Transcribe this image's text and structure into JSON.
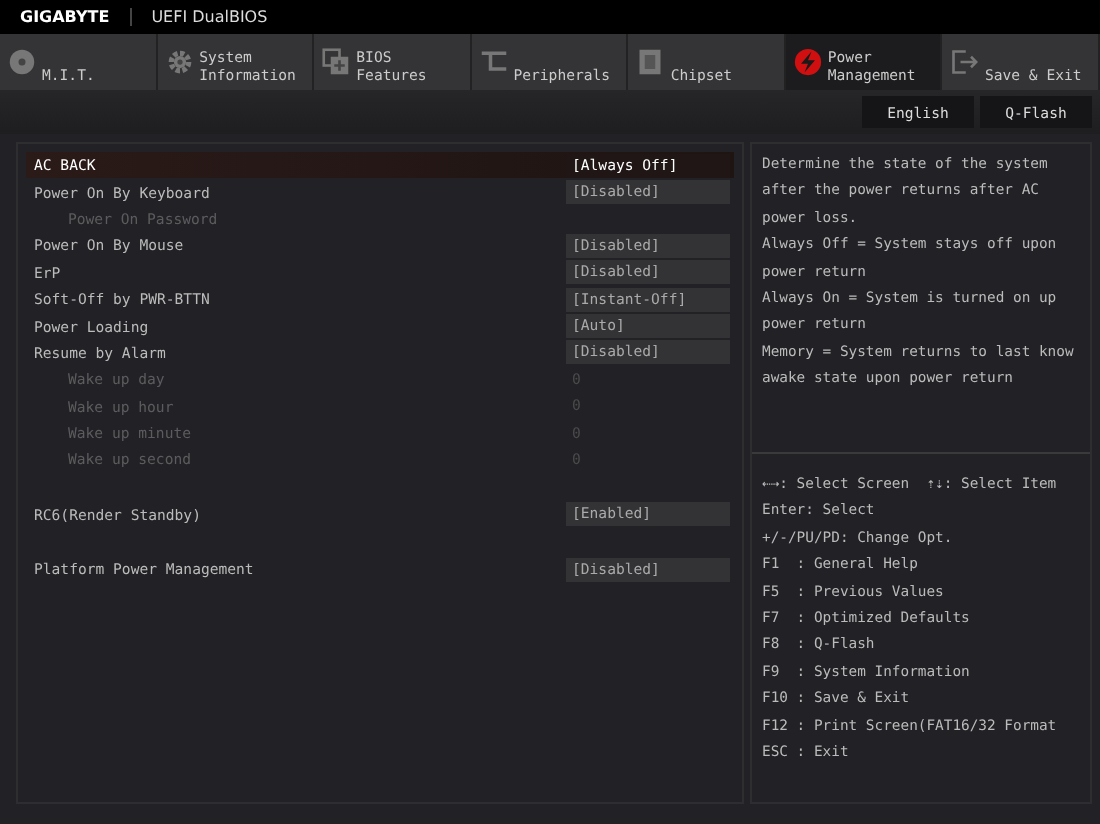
{
  "header": {
    "brand": "GIGABYTE",
    "title": "UEFI DualBIOS"
  },
  "tabs": [
    {
      "label": "M.I.T.",
      "selected": false
    },
    {
      "label": "System\nInformation",
      "selected": false
    },
    {
      "label": "BIOS\nFeatures",
      "selected": false
    },
    {
      "label": "Peripherals",
      "selected": false
    },
    {
      "label": "Chipset",
      "selected": false
    },
    {
      "label": "Power\nManagement",
      "selected": true
    },
    {
      "label": "Save & Exit",
      "selected": false
    }
  ],
  "top_buttons": [
    "English",
    "Q-Flash"
  ],
  "sections": [
    [
      {
        "label": "AC BACK",
        "value": "[Always Off]",
        "selected": true,
        "disabled": false
      },
      {
        "label": "Power On By Keyboard",
        "value": "[Disabled]",
        "selected": false,
        "disabled": false
      },
      {
        "label": "Power On Password",
        "selected": false,
        "disabled": true
      },
      {
        "label": "Power On By Mouse",
        "value": "[Disabled]",
        "selected": false,
        "disabled": false
      },
      {
        "label": "ErP",
        "value": "[Disabled]",
        "selected": false,
        "disabled": false
      },
      {
        "label": "Soft-Off by PWR-BTTN",
        "value": "[Instant-Off]",
        "selected": false,
        "disabled": false
      },
      {
        "label": "Power Loading",
        "value": "[Auto]",
        "selected": false,
        "disabled": false
      },
      {
        "label": "Resume by Alarm",
        "value": "[Disabled]",
        "selected": false,
        "disabled": false
      },
      {
        "label": "Wake up day",
        "value": "0",
        "selected": false,
        "disabled": true
      },
      {
        "label": "Wake up hour",
        "value": "0",
        "selected": false,
        "disabled": true
      },
      {
        "label": "Wake up minute",
        "value": "0",
        "selected": false,
        "disabled": true
      },
      {
        "label": "Wake up second",
        "value": "0",
        "selected": false,
        "disabled": true
      }
    ],
    [
      {
        "label": "RC6(Render Standby)",
        "value": "[Enabled]",
        "selected": false,
        "disabled": false
      }
    ],
    [
      {
        "label": "Platform Power Management",
        "value": "[Disabled]",
        "selected": false,
        "disabled": false
      }
    ]
  ],
  "help": [
    "Determine the state of  the system after the power returns after AC power loss.",
    "Always Off = System stays off upon power return",
    "Always On = System is turned on up power return",
    "Memory = System returns to last know awake state upon power return"
  ],
  "keys": [
    "⇠⇢: Select Screen  ⇡⇣: Select Item",
    "Enter: Select",
    "+/-/PU/PD: Change Opt.",
    "F1  : General Help",
    "F5  : Previous Values",
    "F7  : Optimized Defaults",
    "F8  : Q-Flash",
    "F9  : System Information",
    "F10 : Save & Exit",
    "F12 : Print Screen(FAT16/32 Format",
    "ESC : Exit"
  ]
}
